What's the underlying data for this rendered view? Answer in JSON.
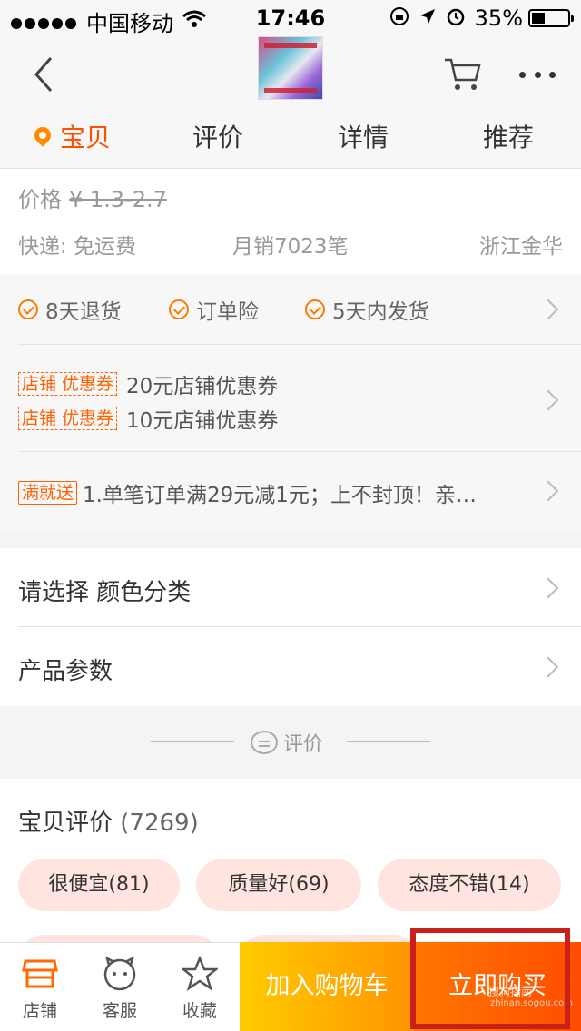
{
  "status_bar": {
    "carrier": "中国移动",
    "time": "17:46",
    "battery": "35%"
  },
  "tabs": [
    {
      "label": "宝贝",
      "active": true
    },
    {
      "label": "评价",
      "active": false
    },
    {
      "label": "详情",
      "active": false
    },
    {
      "label": "推荐",
      "active": false
    }
  ],
  "price": {
    "label": "价格",
    "value": "¥ 1.3-2.7"
  },
  "meta": {
    "shipping": "快递: 免运费",
    "monthly_sales": "月销7023笔",
    "location": "浙江金华"
  },
  "services": [
    "8天退货",
    "订单险",
    "5天内发货"
  ],
  "coupons": {
    "tag": "店铺 优惠券",
    "items": [
      "20元店铺优惠券",
      "10元店铺优惠券"
    ]
  },
  "promotion": {
    "tag": "满就送",
    "text": "1.单笔订单满29元减1元；上不封顶！亲…"
  },
  "options": {
    "choose": "请选择 颜色分类",
    "params": "产品参数"
  },
  "review_divider": {
    "label": "评价"
  },
  "reviews": {
    "title": "宝贝评价",
    "count": "(7269)",
    "chips": [
      "很便宜(81)",
      "质量好(69)",
      "态度不错(14)"
    ]
  },
  "bottom_bar": {
    "shop": "店铺",
    "service": "客服",
    "favorite": "收藏",
    "add_to_cart": "加入购物车",
    "buy_now": "立即购买"
  },
  "watermark": {
    "line1": "搜狗指南",
    "line2": "zhinan.sogou.com"
  },
  "colors": {
    "accent": "#ff5000",
    "highlight_box": "#c8201a"
  }
}
